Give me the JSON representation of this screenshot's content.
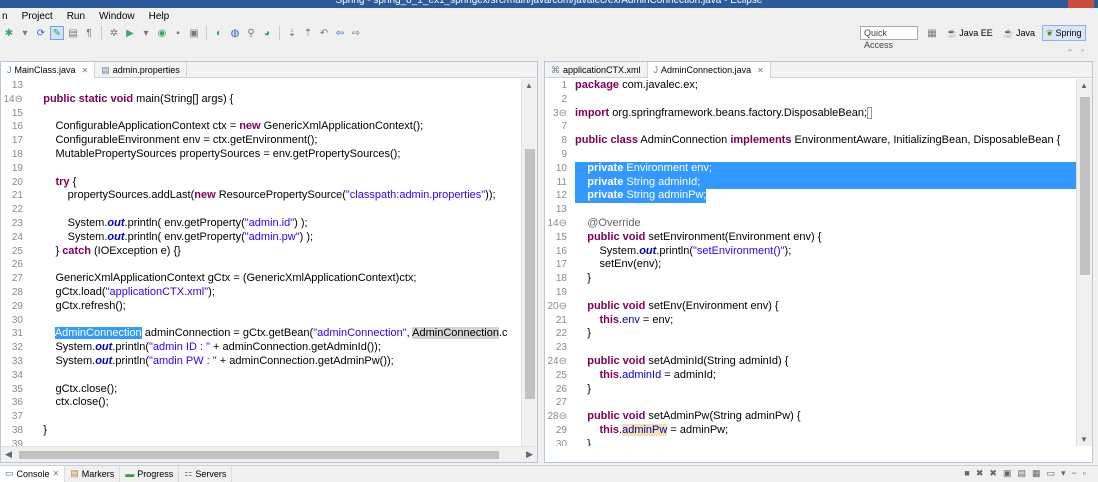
{
  "window": {
    "title": "Spring - spring_8_1_ex1_springex/src/main/java/com/javalec/ex/AdminConnection.java - Eclipse"
  },
  "menu": [
    "n",
    "Project",
    "Run",
    "Window",
    "Help"
  ],
  "toolbar": {
    "quick_access": "Quick Access",
    "perspectives": [
      {
        "label": "Java EE",
        "active": false
      },
      {
        "label": "Java",
        "active": false
      },
      {
        "label": "Spring",
        "active": true
      }
    ]
  },
  "left_editor": {
    "tabs": [
      {
        "label": "MainClass.java",
        "active": true,
        "closable": true
      },
      {
        "label": "admin.properties",
        "active": false,
        "closable": false
      }
    ],
    "lines": [
      {
        "n": "13",
        "html": ""
      },
      {
        "n": "14",
        "fold": true,
        "html": "    <span class='kw'>public static void</span> main(String[] args) {"
      },
      {
        "n": "15",
        "html": ""
      },
      {
        "n": "16",
        "html": "        ConfigurableApplicationContext ctx = <span class='kw'>new</span> GenericXmlApplicationContext();"
      },
      {
        "n": "17",
        "html": "        ConfigurableEnvironment env = ctx.getEnvironment();"
      },
      {
        "n": "18",
        "html": "        MutablePropertySources propertySources = env.getPropertySources();"
      },
      {
        "n": "19",
        "html": ""
      },
      {
        "n": "20",
        "html": "        <span class='kw'>try</span> {"
      },
      {
        "n": "21",
        "html": "            propertySources.addLast(<span class='kw'>new</span> ResourcePropertySource(<span class='str'>\"classpath:admin.properties\"</span>));"
      },
      {
        "n": "22",
        "html": ""
      },
      {
        "n": "23",
        "html": "            System.<span class='fld st'>out</span>.println( env.getProperty(<span class='str'>\"admin.id\"</span>) );"
      },
      {
        "n": "24",
        "html": "            System.<span class='fld st'>out</span>.println( env.getProperty(<span class='str'>\"admin.pw\"</span>) );"
      },
      {
        "n": "25",
        "html": "        } <span class='kw'>catch</span> (IOException e) {}"
      },
      {
        "n": "26",
        "html": ""
      },
      {
        "n": "27",
        "html": "        GenericXmlApplicationContext gCtx = (GenericXmlApplicationContext)ctx;"
      },
      {
        "n": "28",
        "html": "        gCtx.load(<span class='str'>\"applicationCTX.xml\"</span>);"
      },
      {
        "n": "29",
        "html": "        gCtx.refresh();"
      },
      {
        "n": "30",
        "html": ""
      },
      {
        "n": "31",
        "html": "        <span class='sel-bg'>AdminConnection</span> adminConnection = gCtx.getBean(<span class='str'>\"adminConnection\"</span>, <span class='occ'>AdminConnection</span>.c"
      },
      {
        "n": "32",
        "html": "        System.<span class='fld st'>out</span>.println(<span class='str'>\"admin ID : \"</span> + adminConnection.getAdminId());"
      },
      {
        "n": "33",
        "html": "        System.<span class='fld st'>out</span>.println(<span class='str'>\"amdin PW : \"</span> + adminConnection.getAdminPw());"
      },
      {
        "n": "34",
        "html": ""
      },
      {
        "n": "35",
        "html": "        gCtx.close();"
      },
      {
        "n": "36",
        "html": "        ctx.close();"
      },
      {
        "n": "37",
        "html": ""
      },
      {
        "n": "38",
        "html": "    }"
      },
      {
        "n": "39",
        "html": ""
      }
    ]
  },
  "right_editor": {
    "tabs": [
      {
        "label": "applicationCTX.xml",
        "active": false,
        "closable": false
      },
      {
        "label": "AdminConnection.java",
        "active": true,
        "closable": true
      }
    ],
    "lines": [
      {
        "n": "1",
        "html": "<span class='kw'>package</span> com.javalec.ex;"
      },
      {
        "n": "2",
        "html": ""
      },
      {
        "n": "3",
        "fold": true,
        "html": "<span class='kw'>import</span> org.springframework.beans.factory.DisposableBean;<span style='border:1px solid #999;font-size:9px;'>&nbsp;</span>"
      },
      {
        "n": "7",
        "html": ""
      },
      {
        "n": "8",
        "html": "<span class='kw'>public class</span> AdminConnection <span class='kw'>implements</span> EnvironmentAware, InitializingBean, DisposableBean {"
      },
      {
        "n": "9",
        "html": ""
      },
      {
        "n": "10",
        "sel": true,
        "html": "    <span style='font-weight:bold;'>private</span> Environment env;"
      },
      {
        "n": "11",
        "sel": true,
        "html": "    <span style='font-weight:bold;'>private</span> String adminId;"
      },
      {
        "n": "12",
        "sel": true,
        "partial": true,
        "html": "    <span style='font-weight:bold;'>private</span> String adminPw;"
      },
      {
        "n": "13",
        "html": ""
      },
      {
        "n": "14",
        "fold": true,
        "html": "    <span class='ann'>@Override</span>"
      },
      {
        "n": "15",
        "html": "    <span class='kw'>public void</span> setEnvironment(Environment env) {"
      },
      {
        "n": "16",
        "html": "        System.<span class='fld st'>out</span>.println(<span class='str'>\"setEnvironment()\"</span>);"
      },
      {
        "n": "17",
        "html": "        setEnv(env);"
      },
      {
        "n": "18",
        "html": "    }"
      },
      {
        "n": "19",
        "html": ""
      },
      {
        "n": "20",
        "fold": true,
        "html": "    <span class='kw'>public void</span> setEnv(Environment env) {"
      },
      {
        "n": "21",
        "html": "        <span class='kw'>this</span>.<span class='fld'>env</span> = env;"
      },
      {
        "n": "22",
        "html": "    }"
      },
      {
        "n": "23",
        "html": ""
      },
      {
        "n": "24",
        "fold": true,
        "html": "    <span class='kw'>public void</span> setAdminId(String adminId) {"
      },
      {
        "n": "25",
        "html": "        <span class='kw'>this</span>.<span class='fld'>adminId</span> = adminId;"
      },
      {
        "n": "26",
        "html": "    }"
      },
      {
        "n": "27",
        "html": ""
      },
      {
        "n": "28",
        "fold": true,
        "html": "    <span class='kw'>public void</span> setAdminPw(String adminPw) {"
      },
      {
        "n": "29",
        "html": "        <span class='kw'>this</span>.<span class='fld occ2'>adminPw</span> = adminPw;"
      },
      {
        "n": "30",
        "html": "    }"
      }
    ]
  },
  "bottom_panel": {
    "tabs": [
      {
        "label": "Console",
        "active": true,
        "closable": true
      },
      {
        "label": "Markers",
        "active": false
      },
      {
        "label": "Progress",
        "active": false
      },
      {
        "label": "Servers",
        "active": false
      }
    ]
  }
}
